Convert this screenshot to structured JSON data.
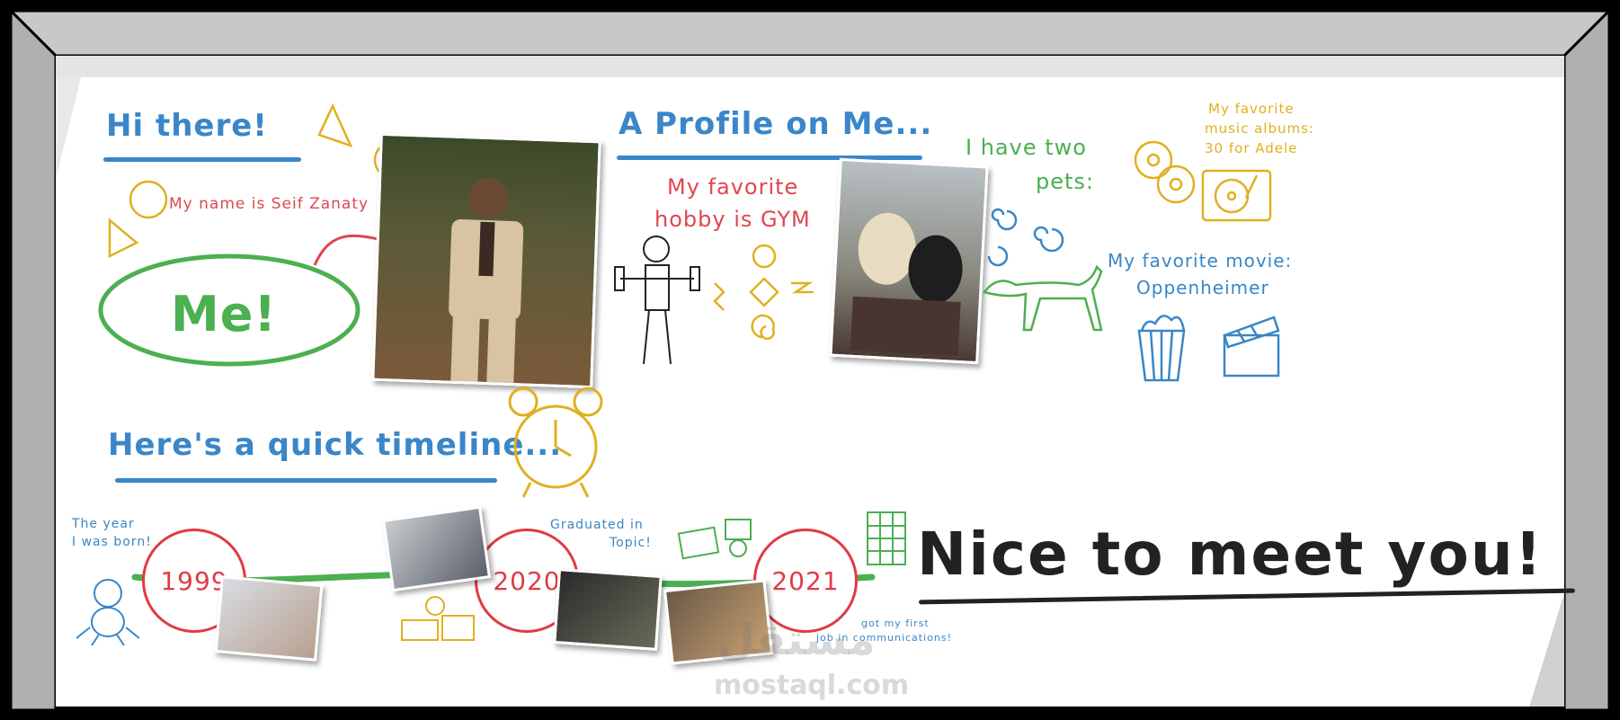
{
  "greeting": {
    "title": "Hi there!",
    "name_line": "My name is Seif Zanaty",
    "me_label": "Me!"
  },
  "profile": {
    "title": "A Profile on Me...",
    "hobby_line1": "My favorite",
    "hobby_line2": "hobby is GYM",
    "pets_line1": "I have two",
    "pets_line2": "pets:",
    "music_line1": "My favorite",
    "music_line2": "music albums:",
    "music_line3": "30 for Adele",
    "movie_line1": "My favorite movie:",
    "movie_line2": "Oppenheimer"
  },
  "timeline": {
    "title": "Here's a quick timeline...",
    "born_note_line1": "The year",
    "born_note_line2": "I was born!",
    "graduated_line1": "Graduated in",
    "graduated_line2": "Topic!",
    "job_line1": "got my first",
    "job_line2": "job in communications!",
    "years": [
      "1999",
      "2020",
      "2021"
    ]
  },
  "closing": "Nice to meet you!",
  "watermark": {
    "arabic": "مستقل",
    "latin": "mostaql.com"
  },
  "colors": {
    "accent_blue": "#3a86c8",
    "accent_red": "#e0464f",
    "accent_green": "#4caf50",
    "accent_yellow": "#e0b020",
    "frame_gray": "#b9b9b9"
  }
}
